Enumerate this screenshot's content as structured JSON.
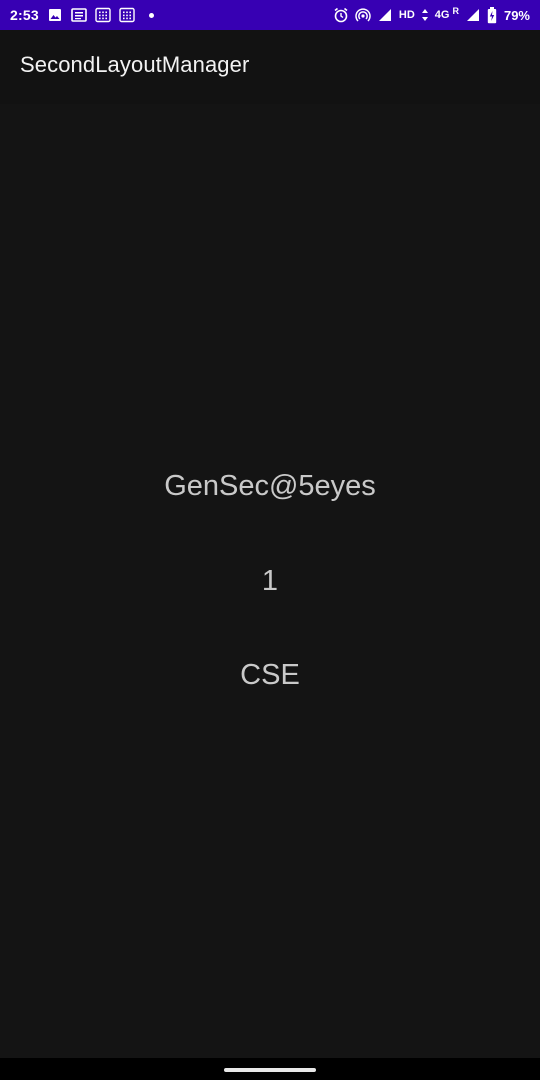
{
  "status_bar": {
    "time": "2:53",
    "network": "HD",
    "signal_type": "4G",
    "roaming": "R",
    "battery": "79%",
    "background": "#3700b3",
    "left_icons": [
      "gallery-icon",
      "news-icon",
      "keypad-icon",
      "keypad-icon",
      "notification-dot-icon"
    ],
    "right_icons": [
      "alarm-icon",
      "hotspot-icon",
      "signal-icon",
      "signal-icon",
      "battery-charging-icon"
    ]
  },
  "app_bar": {
    "title": "SecondLayoutManager"
  },
  "content": {
    "lines": [
      "GenSec@5eyes",
      "1",
      "CSE"
    ]
  },
  "colors": {
    "background": "#141414",
    "text": "#c9c9c9",
    "title": "#f2f2f2"
  }
}
